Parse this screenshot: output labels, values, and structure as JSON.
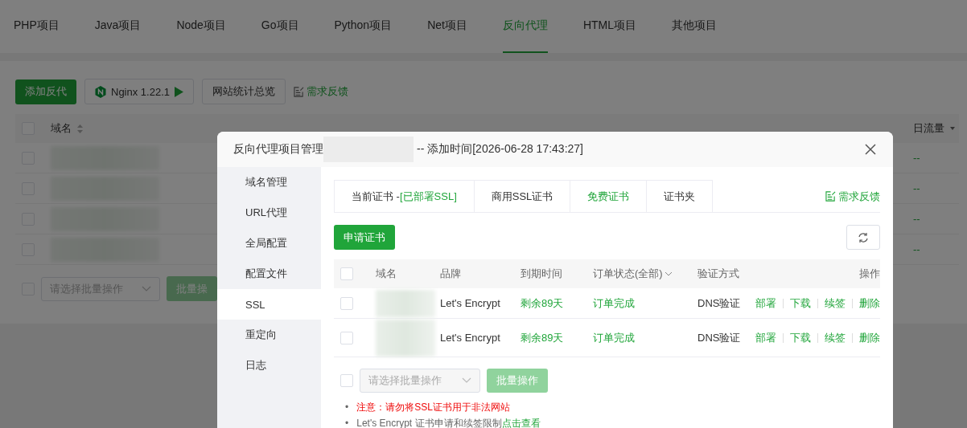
{
  "project_tabs": [
    {
      "label": "PHP项目",
      "selected": false
    },
    {
      "label": "Java项目",
      "selected": false
    },
    {
      "label": "Node项目",
      "selected": false
    },
    {
      "label": "Go项目",
      "selected": false
    },
    {
      "label": "Python项目",
      "selected": false
    },
    {
      "label": "Net项目",
      "selected": false
    },
    {
      "label": "反向代理",
      "selected": true
    },
    {
      "label": "HTML项目",
      "selected": false
    },
    {
      "label": "其他项目",
      "selected": false
    }
  ],
  "toolbar": {
    "add_button": "添加反代",
    "nginx_button": "Nginx 1.22.1",
    "stats_button": "网站统计总览",
    "feedback_link": "需求反馈"
  },
  "table": {
    "select_all_checked": false,
    "columns": [
      {
        "label": "域名",
        "kind": "sortable"
      },
      {
        "label": "日流量",
        "kind": "dropdown"
      }
    ],
    "rows": [
      {
        "checked": false,
        "traffic": "--"
      },
      {
        "checked": false,
        "traffic": "--"
      },
      {
        "checked": false,
        "traffic": "--"
      },
      {
        "checked": false,
        "traffic": "--"
      }
    ]
  },
  "batch": {
    "checked": false,
    "placeholder": "请选择批量操作",
    "button": "批量操"
  },
  "modal": {
    "title": "反向代理项目管理",
    "title_suffix": "-- 添加时间[2026-06-28 17:43:27]",
    "sidebar": [
      {
        "label": "域名管理",
        "selected": false
      },
      {
        "label": "URL代理",
        "selected": false
      },
      {
        "label": "全局配置",
        "selected": false
      },
      {
        "label": "配置文件",
        "selected": false
      },
      {
        "label": "SSL",
        "selected": true
      },
      {
        "label": "重定向",
        "selected": false
      },
      {
        "label": "日志",
        "selected": false
      }
    ],
    "cert_tabs": [
      {
        "label": "当前证书 -",
        "status": "[已部署SSL]",
        "selected": false
      },
      {
        "label": "商用SSL证书",
        "selected": false
      },
      {
        "label": "免费证书",
        "selected": true
      },
      {
        "label": "证书夹",
        "selected": false
      }
    ],
    "feedback_link": "需求反馈",
    "apply_button": "申请证书",
    "cert_table": {
      "select_all_checked": false,
      "columns": [
        {
          "label": "域名",
          "kind": "plain"
        },
        {
          "label": "品牌",
          "kind": "plain"
        },
        {
          "label": "到期时间",
          "kind": "plain"
        },
        {
          "label": "订单状态(全部)",
          "kind": "dropdown"
        },
        {
          "label": "验证方式",
          "kind": "plain"
        },
        {
          "label": "操作",
          "kind": "plain"
        }
      ],
      "rows": [
        {
          "checked": false,
          "brand": "Let's Encrypt",
          "expiry": "剩余89天",
          "status": "订单完成",
          "verify": "DNS验证",
          "actions": [
            "部署",
            "下载",
            "续签",
            "删除"
          ]
        },
        {
          "checked": false,
          "brand": "Let's Encrypt",
          "expiry": "剩余89天",
          "status": "订单完成",
          "verify": "DNS验证",
          "actions": [
            "部署",
            "下载",
            "续签",
            "删除"
          ]
        }
      ]
    },
    "batch": {
      "checked": false,
      "placeholder": "请选择批量操作",
      "button": "批量操作"
    },
    "notes": [
      {
        "kind": "warning",
        "bullet": "•",
        "text": "注意：请勿将SSL证书用于非法网站"
      },
      {
        "kind": "info",
        "bullet": "•",
        "text": "Let's Encrypt 证书申请和续签限制",
        "link": "点击查看"
      }
    ]
  }
}
